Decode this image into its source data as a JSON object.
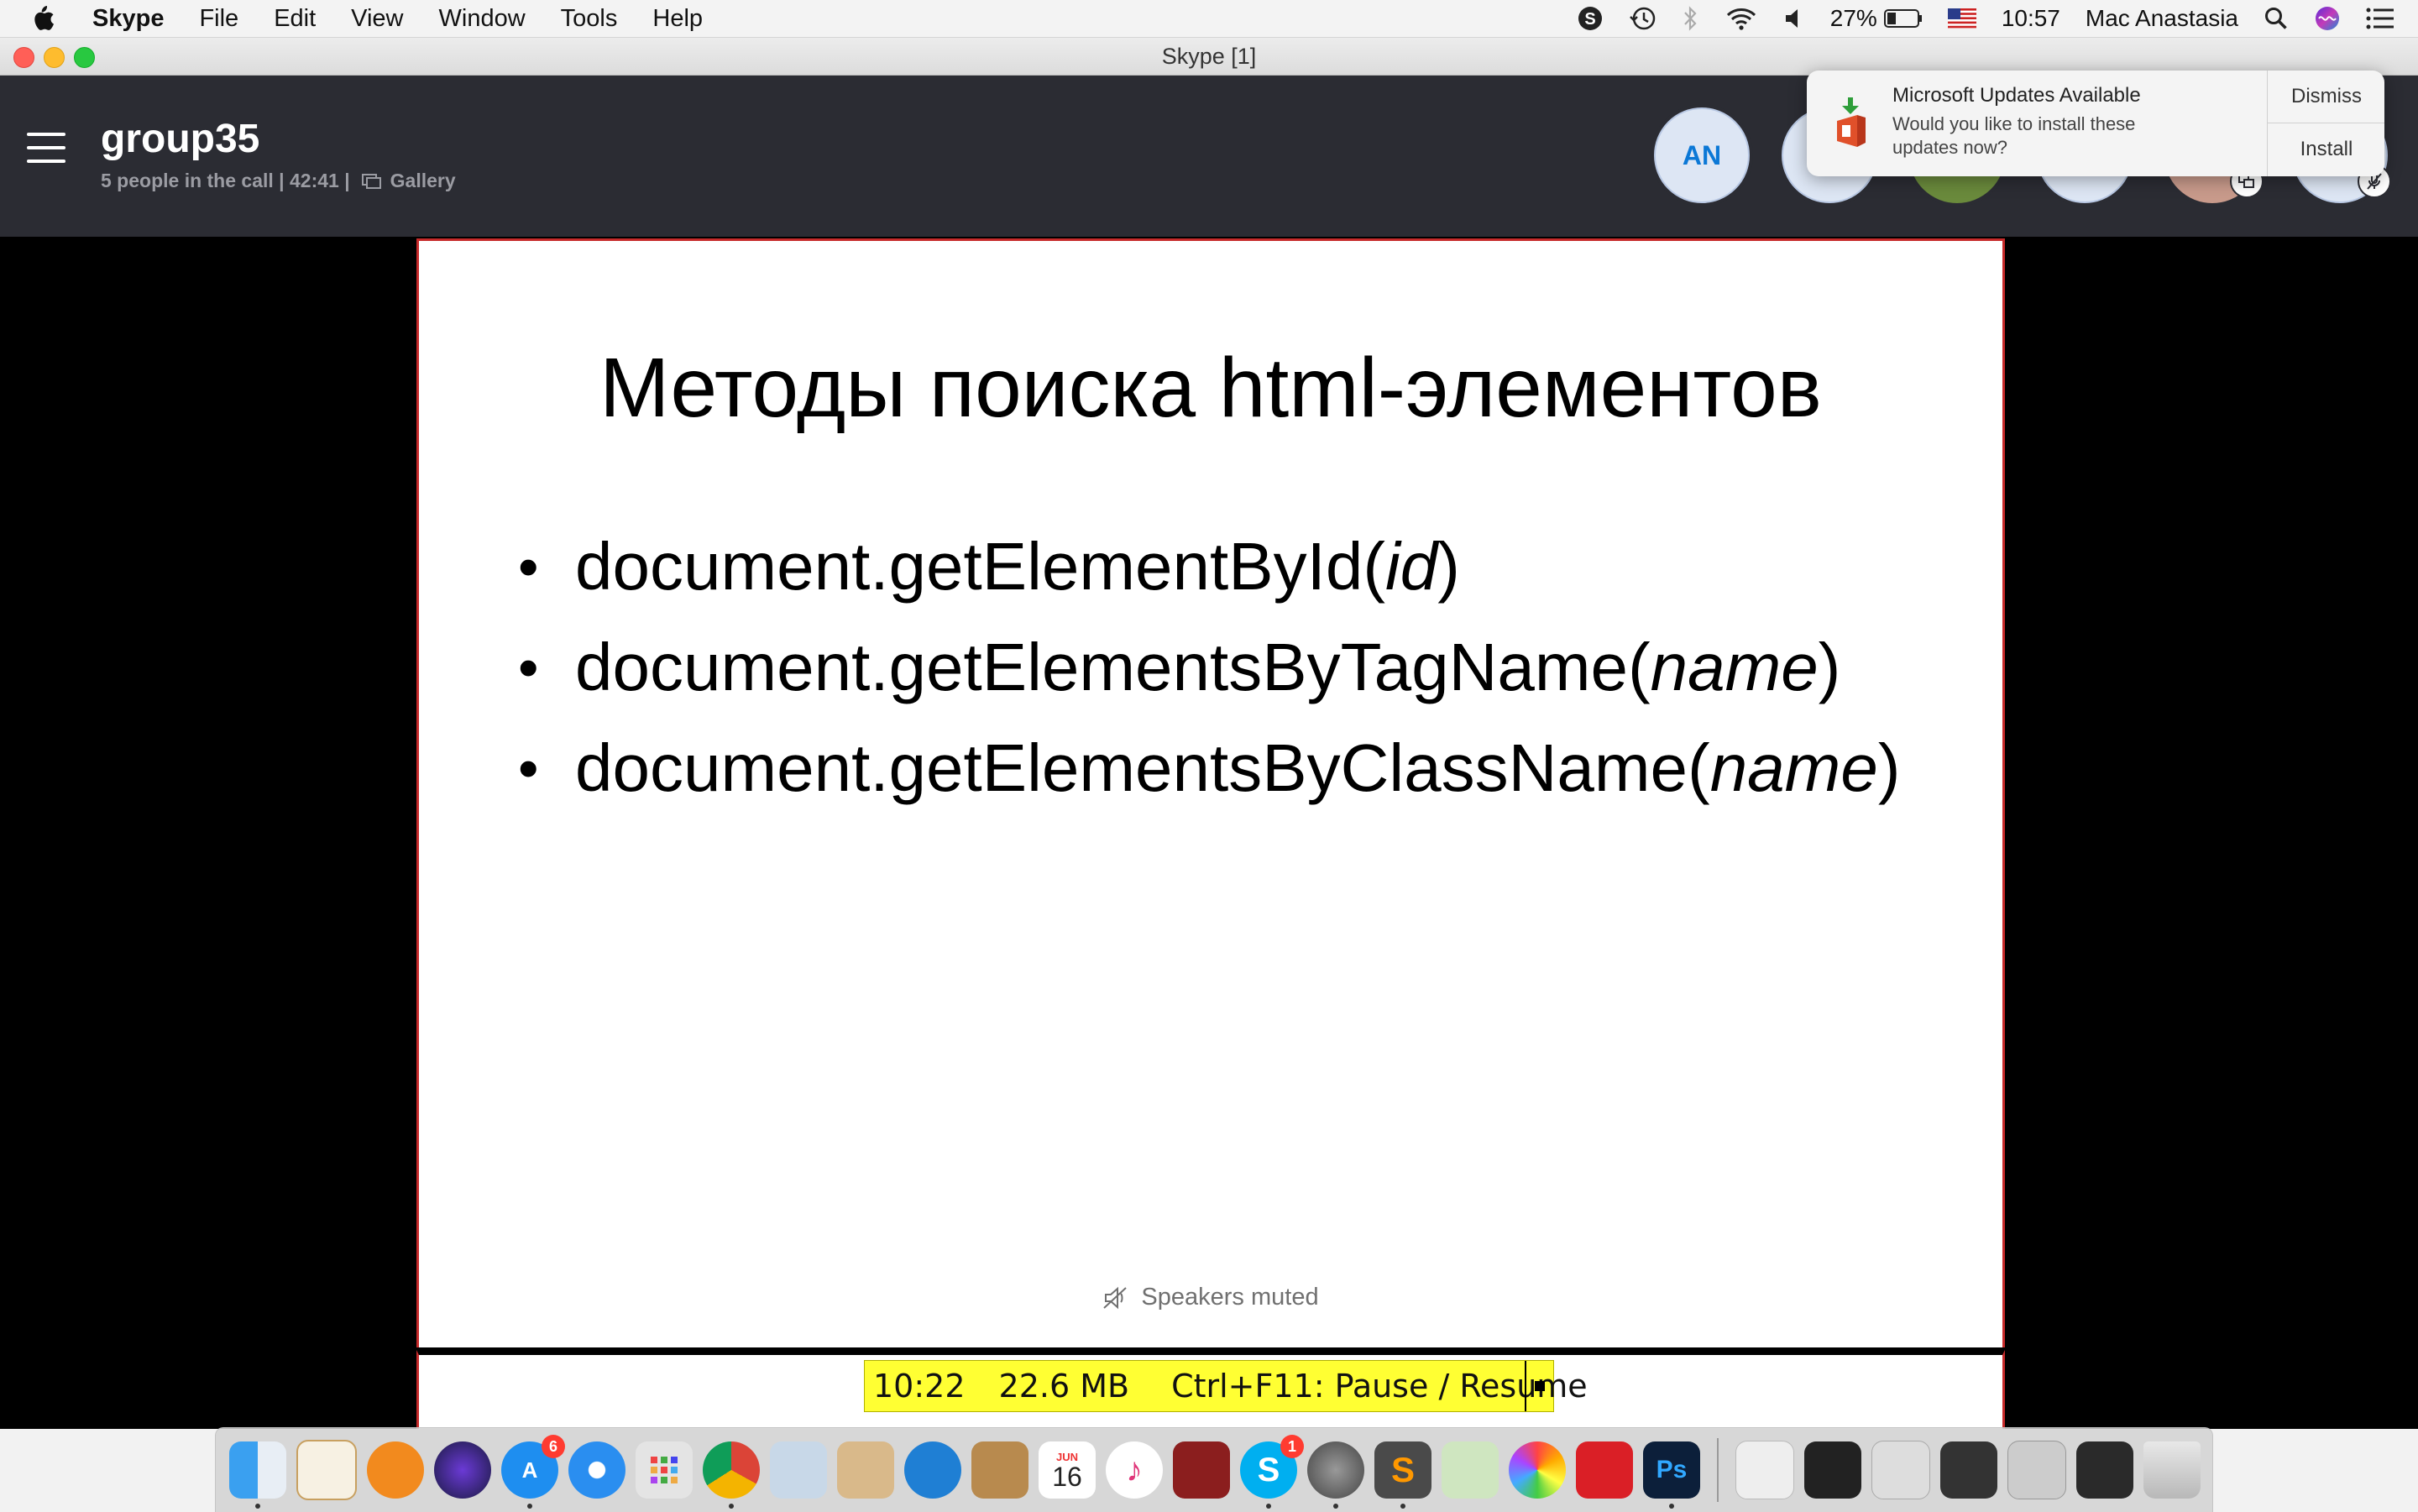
{
  "menubar": {
    "app_name": "Skype",
    "items": [
      "File",
      "Edit",
      "View",
      "Window",
      "Tools",
      "Help"
    ],
    "battery": "27%",
    "time": "10:57",
    "user": "Mac Anastasia"
  },
  "window": {
    "title": "Skype [1]"
  },
  "call": {
    "name": "group35",
    "subtitle": "5 people in the call | 42:41 |",
    "view_mode": "Gallery",
    "participants": [
      {
        "initials": "AN"
      }
    ]
  },
  "notification": {
    "title": "Microsoft Updates Available",
    "body": "Would you like to install these updates now?",
    "dismiss_label": "Dismiss",
    "install_label": "Install"
  },
  "slide": {
    "title": "Методы поиска html-элементов",
    "bullets": [
      {
        "text": "document.getElementById(",
        "param": "id",
        "close": ")"
      },
      {
        "text": "document.getElementsByTagName(",
        "param": "name",
        "close": ")"
      },
      {
        "text": "document.getElementsByClassName(",
        "param": "name",
        "close": ")"
      }
    ],
    "bullet_glyph": "•"
  },
  "status": {
    "speakers": "Speakers muted"
  },
  "recorder": {
    "time": "10:22",
    "size": "22.6 MB",
    "hint": "Ctrl+F11: Pause / Resume"
  },
  "dock": {
    "app_store_badge": "6",
    "calendar_month": "JUN",
    "calendar_day": "16",
    "skype_badge": "1"
  },
  "colors": {
    "skype_header": "#2b2c33",
    "slide_border": "#c62a2a",
    "recorder_bg": "#ffff33",
    "avatar_text": "#0b78d6"
  }
}
